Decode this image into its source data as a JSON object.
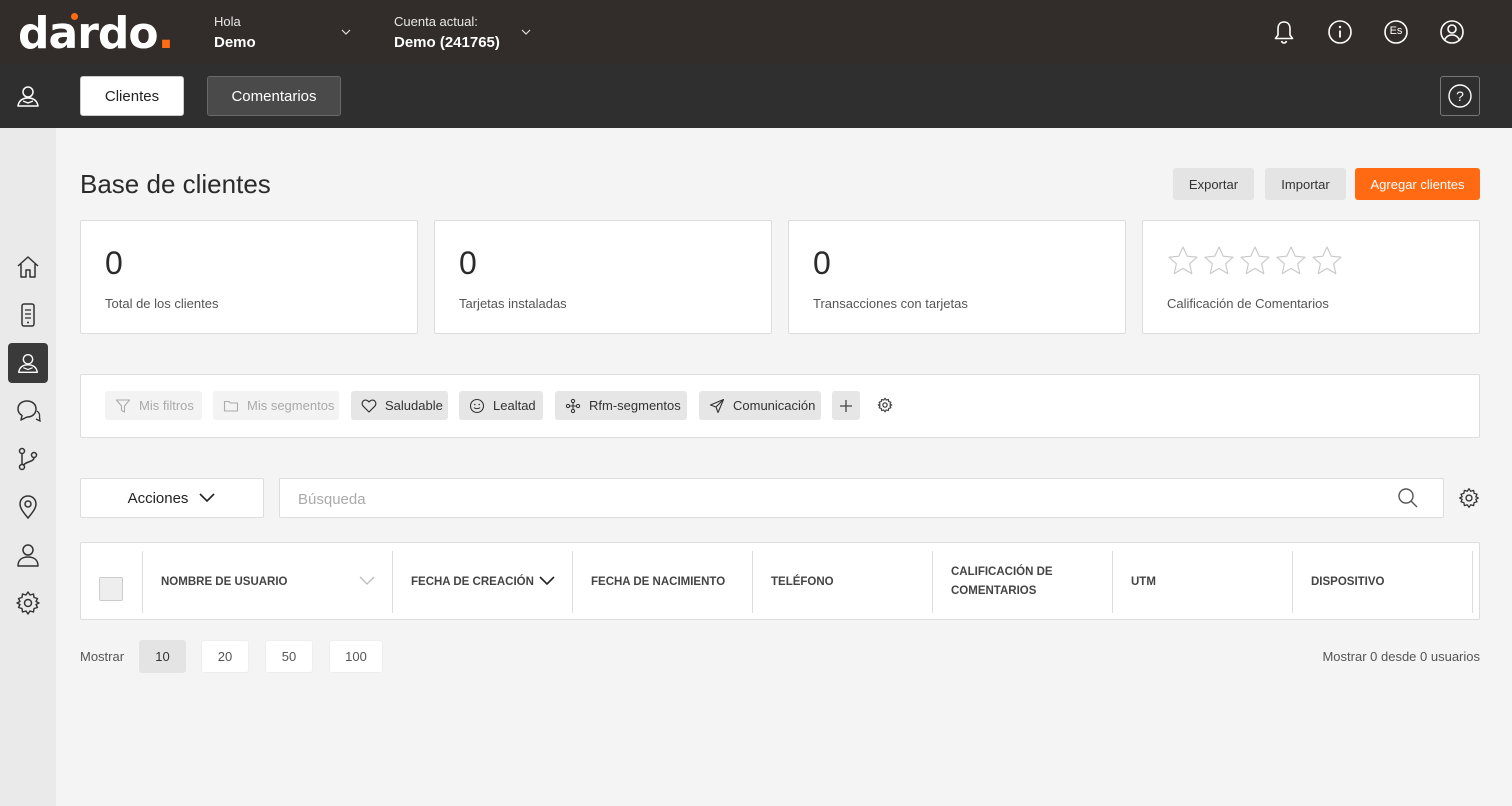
{
  "brand": {
    "name_main": "dardo",
    "name_dot": ".",
    "accent_color": "#ff6a13"
  },
  "header": {
    "greeting_label": "Hola",
    "user_name": "Demo",
    "account_label": "Cuenta actual:",
    "account_value": "Demo (241765)",
    "language_badge": "Es",
    "icons": [
      "bell-icon",
      "info-icon",
      "language-icon",
      "user-icon"
    ]
  },
  "subnav": {
    "tabs": [
      {
        "label": "Clientes",
        "active": true
      },
      {
        "label": "Comentarios",
        "active": false
      }
    ],
    "help_glyph": "?"
  },
  "sidebar": {
    "items": [
      {
        "icon": "home-icon"
      },
      {
        "icon": "device-icon"
      },
      {
        "icon": "customers-icon",
        "active": true
      },
      {
        "icon": "chat-icon"
      },
      {
        "icon": "flow-icon"
      },
      {
        "icon": "location-icon"
      },
      {
        "icon": "user-icon"
      },
      {
        "icon": "settings-icon"
      }
    ]
  },
  "page": {
    "title": "Base de clientes",
    "actions": {
      "export": "Exportar",
      "import": "Importar",
      "add": "Agregar clientes"
    }
  },
  "stats": [
    {
      "value": "0",
      "label": "Total de los clientes"
    },
    {
      "value": "0",
      "label": "Tarjetas instaladas"
    },
    {
      "value": "0",
      "label": "Transacciones con tarjetas"
    },
    {
      "rating": 0,
      "max_rating": 5,
      "label": "Calificación de Comentarios"
    }
  ],
  "filters": {
    "chips": [
      {
        "label": "Mis filtros",
        "icon": "filter-icon",
        "disabled": true
      },
      {
        "label": "Mis segmentos",
        "icon": "folder-icon",
        "disabled": true
      },
      {
        "label": "Saludable",
        "icon": "heart-icon",
        "disabled": false
      },
      {
        "label": "Lealtad",
        "icon": "smile-icon",
        "disabled": false
      },
      {
        "label": "Rfm-segmentos",
        "icon": "segments-icon",
        "disabled": false
      },
      {
        "label": "Comunicación",
        "icon": "send-icon",
        "disabled": false
      }
    ]
  },
  "toolbar": {
    "actions_label": "Acciones",
    "search_placeholder": "Búsqueda",
    "search_value": ""
  },
  "table": {
    "columns": [
      "NOMBRE DE USUARIO",
      "FECHA DE CREACIÓN",
      "FECHA DE NACIMIENTO",
      "TELÉFONO",
      "CALIFICACIÓN DE COMENTARIOS",
      "UTM",
      "DISPOSITIVO"
    ],
    "rows": []
  },
  "pagination": {
    "show_label": "Mostrar",
    "sizes": [
      "10",
      "20",
      "50",
      "100"
    ],
    "selected": "10",
    "summary": "Mostrar 0 desde 0 usuarios"
  }
}
